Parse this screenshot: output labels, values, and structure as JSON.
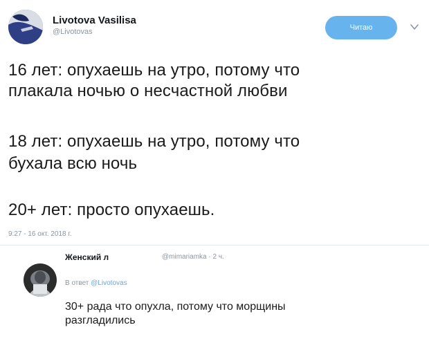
{
  "tweet": {
    "author_name": "Livotova Vasilisa",
    "author_handle": "@Livotovas",
    "follow_label": "Читаю",
    "lines": [
      "16 лет: опухаешь на утро, потому что",
      "плакала ночью о несчастной любви",
      "18 лет: опухаешь на утро, потому что",
      "бухала всю ночь",
      "20+ лет: просто опухаешь."
    ],
    "timestamp": "9:27 - 16 окт. 2018 г."
  },
  "reply": {
    "author_name": "Женский л",
    "author_handle": "@mimariamka",
    "time_ago": "2 ч.",
    "reply_to_prefix": "В ответ",
    "reply_to_handle": "@Livotovas",
    "lines": [
      "30+ рада что опухла, потому что морщины",
      "разгладились"
    ]
  },
  "colors": {
    "follow_button": "#67b3ee",
    "secondary_text": "#8a96a3",
    "link": "#6aa7d8",
    "divider": "#e6ecf0"
  },
  "icons": {
    "more": "chevron-down-icon"
  }
}
